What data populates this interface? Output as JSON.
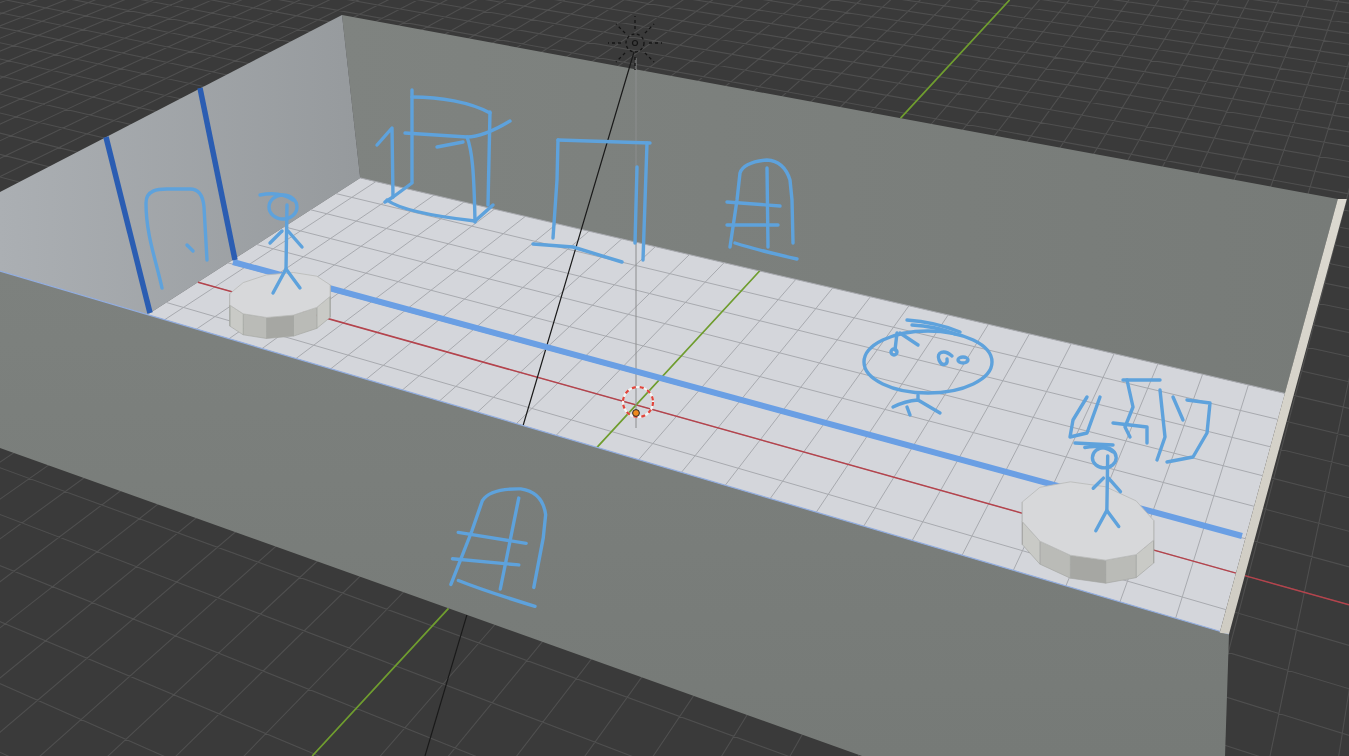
{
  "viewport": {
    "grid": {
      "kind": "perspective"
    },
    "axes": [
      {
        "kind": "x"
      },
      {
        "kind": "y"
      }
    ],
    "lamp": {
      "kind": "sun"
    },
    "cursor": {
      "kind": "ring"
    },
    "origin": {
      "kind": "dot"
    }
  },
  "room": {
    "walls": [
      {
        "kind": "back"
      },
      {
        "kind": "left"
      },
      {
        "kind": "front"
      },
      {
        "kind": "right"
      }
    ],
    "floor": {
      "kind": "tiled"
    },
    "pedestals": [
      {
        "kind": "cylinder"
      },
      {
        "kind": "cylinder"
      }
    ]
  },
  "sketches": [
    {
      "kind": "edge"
    },
    {
      "kind": "edge"
    },
    {
      "kind": "door"
    },
    {
      "kind": "figure"
    },
    {
      "kind": "cabinet"
    },
    {
      "kind": "doorway"
    },
    {
      "kind": "window"
    },
    {
      "kind": "stripe"
    },
    {
      "kind": "face"
    },
    {
      "kind": "chairs"
    },
    {
      "kind": "figure"
    },
    {
      "kind": "window"
    }
  ]
}
